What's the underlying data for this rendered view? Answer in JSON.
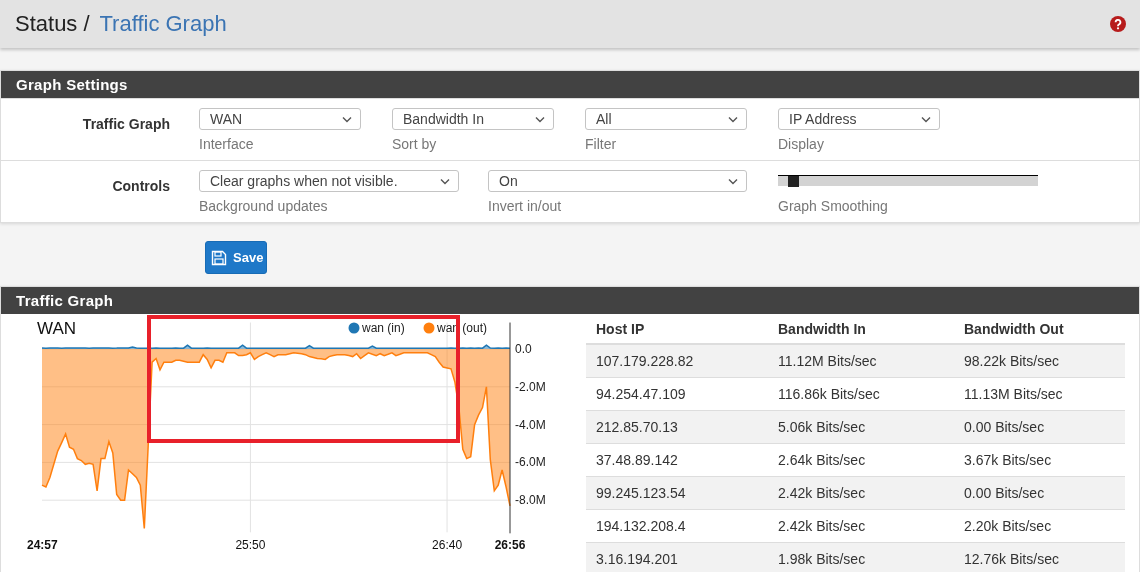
{
  "breadcrumb": {
    "items": [
      {
        "label": "Status",
        "link": false
      },
      {
        "label": "Traffic Graph",
        "link": true
      }
    ],
    "separator": "/"
  },
  "settings_panel": {
    "title": "Graph Settings",
    "rows": [
      {
        "label": "Traffic Graph",
        "fields": [
          {
            "kind": "select",
            "value": "WAN",
            "help": "Interface"
          },
          {
            "kind": "select",
            "value": "Bandwidth In",
            "help": "Sort by"
          },
          {
            "kind": "select",
            "value": "All",
            "help": "Filter"
          },
          {
            "kind": "select",
            "value": "IP Address",
            "help": "Display"
          }
        ]
      },
      {
        "label": "Controls",
        "fields": [
          {
            "kind": "select",
            "value": "Clear graphs when not visible.",
            "help": "Background updates"
          },
          {
            "kind": "select",
            "value": "On",
            "help": "Invert in/out"
          },
          {
            "kind": "slider",
            "level": 0.04,
            "help": "Graph Smoothing"
          }
        ]
      }
    ]
  },
  "save_button": {
    "label": "Save"
  },
  "graph_panel": {
    "title": "Traffic Graph",
    "highlight_box": {
      "color": "#e8202a"
    },
    "chart_data": {
      "type": "area",
      "title": "WAN",
      "grid": true,
      "legend": "top-right",
      "ylim": [
        -9.7,
        1.4
      ],
      "categories": [
        "24:57",
        null,
        null,
        null,
        null,
        null,
        null,
        null,
        null,
        null,
        null,
        null,
        null,
        null,
        null,
        null,
        null,
        null,
        null,
        null,
        null,
        null,
        null,
        null,
        null,
        null,
        null,
        null,
        null,
        null,
        null,
        null,
        null,
        null,
        null,
        null,
        null,
        null,
        null,
        null,
        null,
        null,
        null,
        null,
        null,
        null,
        null,
        null,
        null,
        null,
        null,
        null,
        null,
        "25:50",
        null,
        null,
        null,
        null,
        null,
        null,
        null,
        null,
        null,
        null,
        null,
        null,
        null,
        null,
        null,
        null,
        null,
        null,
        null,
        null,
        null,
        null,
        null,
        null,
        null,
        null,
        null,
        null,
        null,
        null,
        null,
        null,
        null,
        null,
        null,
        null,
        null,
        null,
        null,
        null,
        null,
        null,
        null,
        null,
        null,
        null,
        null,
        null,
        null,
        "26:40",
        null,
        null,
        null,
        null,
        null,
        null,
        null,
        null,
        null,
        null,
        null,
        null,
        null,
        null,
        null,
        "26:56"
      ],
      "yticks": [
        {
          "value": 0,
          "label": "0.0"
        },
        {
          "value": -2,
          "label": "-2.0M"
        },
        {
          "value": -4,
          "label": "-4.0M"
        },
        {
          "value": -6,
          "label": "-6.0M"
        },
        {
          "value": -8,
          "label": "-8.0M"
        }
      ],
      "series": [
        {
          "name": "wan (in)",
          "color": "#1f77b4",
          "values": [
            0.05,
            0.04,
            0.06,
            0.05,
            0.05,
            0.04,
            0.05,
            0.05,
            0.06,
            0.05,
            0.05,
            0.05,
            0.04,
            0.05,
            0.05,
            0.06,
            0.05,
            0.05,
            0.04,
            0.05,
            0.06,
            0.05,
            0.05,
            0.1,
            0.05,
            0.04,
            0.04,
            0.04,
            0.04,
            0.05,
            0.04,
            0.04,
            0.04,
            0.04,
            0.05,
            0.04,
            0.04,
            0.2,
            0.04,
            0.04,
            0.04,
            0.04,
            0.05,
            0.04,
            0.04,
            0.04,
            0.04,
            0.04,
            0.04,
            0.04,
            0.04,
            0.2,
            0.04,
            0.04,
            0.04,
            0.04,
            0.04,
            0.04,
            0.04,
            0.04,
            0.04,
            0.04,
            0.04,
            0.04,
            0.04,
            0.04,
            0.04,
            0.04,
            0.18,
            0.04,
            0.04,
            0.04,
            0.04,
            0.04,
            0.04,
            0.04,
            0.04,
            0.04,
            0.04,
            0.04,
            0.04,
            0.04,
            0.04,
            0.04,
            0.15,
            0.04,
            0.04,
            0.04,
            0.04,
            0.04,
            0.04,
            0.04,
            0.04,
            0.04,
            0.04,
            0.04,
            0.04,
            0.04,
            0.04,
            0.04,
            0.04,
            0.04,
            0.04,
            0.04,
            0.05,
            0.04,
            0.04,
            0.05,
            0.04,
            0.05,
            0.04,
            0.05,
            0.04,
            0.2,
            0.05,
            0.04,
            0.05,
            0.04,
            0.05,
            0.04
          ]
        },
        {
          "name": "wan (out)",
          "color": "#ff7f0e",
          "values": [
            -7.2,
            -7.3,
            -6.8,
            -6.1,
            -5.4,
            -4.95,
            -4.5,
            -5.2,
            -5.3,
            -5.8,
            -5.9,
            -6.1,
            -6.05,
            -6.1,
            -7.5,
            -5.8,
            -5.8,
            -4.9,
            -5.5,
            -7.7,
            -8.0,
            -8.0,
            -6.4,
            -6.6,
            -6.8,
            -7.2,
            -9.5,
            -5.1,
            -0.7,
            -0.5,
            -1.1,
            -0.7,
            -0.7,
            -0.7,
            -0.6,
            -0.6,
            -0.65,
            -0.7,
            -0.7,
            -0.7,
            -0.7,
            -0.3,
            -0.55,
            -1.0,
            -0.6,
            -0.6,
            -0.7,
            -0.2,
            -0.2,
            -0.2,
            -0.35,
            -0.35,
            -0.3,
            -0.2,
            -0.55,
            -0.4,
            -0.3,
            -0.2,
            -0.3,
            -0.4,
            -0.3,
            -0.3,
            -0.3,
            -0.25,
            -0.2,
            -0.22,
            -0.25,
            -0.3,
            -0.4,
            -0.45,
            -0.5,
            -0.52,
            -0.55,
            -0.4,
            -0.35,
            -0.3,
            -0.3,
            -0.3,
            -0.35,
            -0.4,
            -0.25,
            -0.5,
            -0.35,
            -0.2,
            -0.28,
            -0.35,
            -0.25,
            -0.35,
            -0.28,
            -0.2,
            -0.35,
            -0.28,
            -0.2,
            -0.2,
            -0.2,
            -0.2,
            -0.2,
            -0.2,
            -0.2,
            -0.3,
            -0.4,
            -0.7,
            -0.95,
            -1.0,
            -1.05,
            -1.75,
            -3.1,
            -5.3,
            -5.8,
            -5.7,
            -4.0,
            -3.5,
            -3.1,
            -2.0,
            -5.85,
            -7.5,
            -7.2,
            -6.4,
            -7.3,
            -8.3
          ]
        }
      ]
    },
    "table": {
      "columns": [
        "Host IP",
        "Bandwidth In",
        "Bandwidth Out"
      ],
      "rows": [
        [
          "107.179.228.82",
          "11.12M Bits/sec",
          "98.22k Bits/sec"
        ],
        [
          "94.254.47.109",
          "116.86k Bits/sec",
          "11.13M Bits/sec"
        ],
        [
          "212.85.70.13",
          "5.06k Bits/sec",
          "0.00 Bits/sec"
        ],
        [
          "37.48.89.142",
          "2.64k Bits/sec",
          "3.67k Bits/sec"
        ],
        [
          "99.245.123.54",
          "2.42k Bits/sec",
          "0.00 Bits/sec"
        ],
        [
          "194.132.208.4",
          "2.42k Bits/sec",
          "2.20k Bits/sec"
        ],
        [
          "3.16.194.201",
          "1.98k Bits/sec",
          "12.76k Bits/sec"
        ]
      ]
    }
  }
}
